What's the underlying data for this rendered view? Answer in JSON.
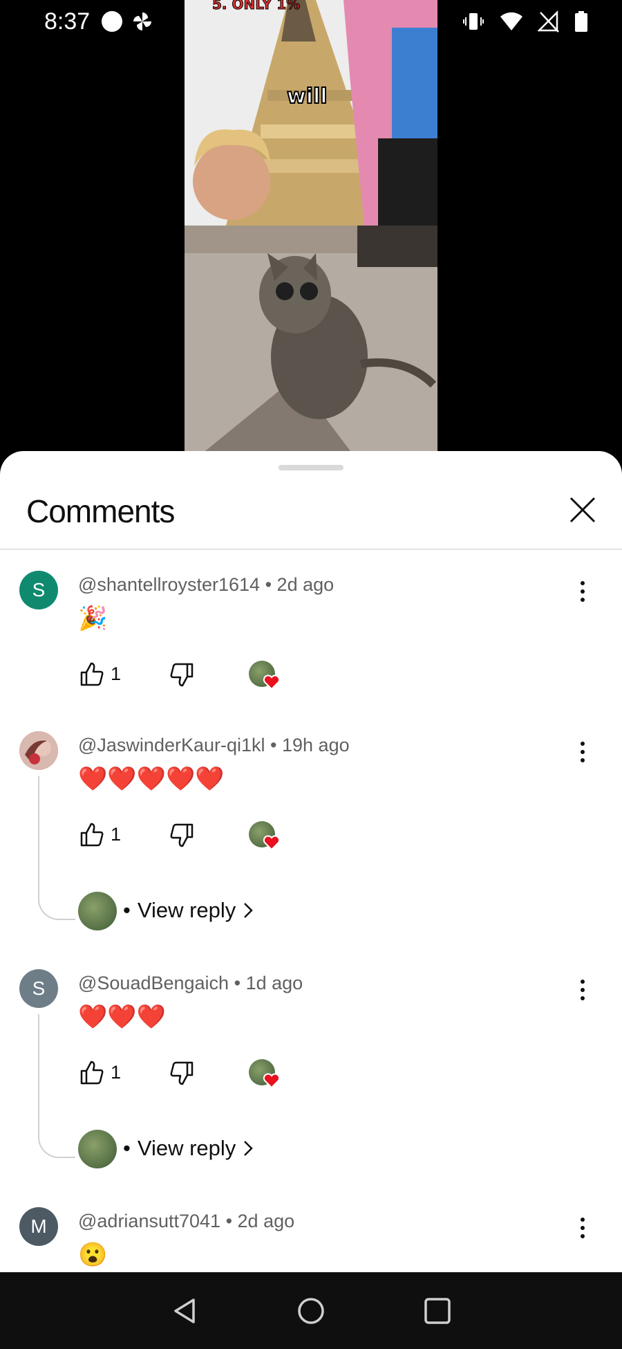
{
  "status_bar": {
    "time": "8:37",
    "left_icons": [
      "circle-dot-icon",
      "pinwheel-icon"
    ],
    "right_icons": [
      "vibrate-icon",
      "wifi-icon",
      "no-signal-icon",
      "battery-icon"
    ]
  },
  "video": {
    "banner_text": "5. ONLY 1%",
    "caption": "will"
  },
  "comments_panel": {
    "title": "Comments",
    "close_icon": "close-icon",
    "comments": [
      {
        "avatar_letter": "S",
        "avatar_color": "#0f8a6f",
        "author": "@shantellroyster1614",
        "age": "2d ago",
        "text": "🎉",
        "likes": "1",
        "creator_heart": true
      },
      {
        "avatar_letter": "",
        "avatar_color": "#c9a09a",
        "author": "@JaswinderKaur-qi1kl",
        "age": "19h ago",
        "text": "❤️❤️❤️❤️❤️",
        "likes": "1",
        "creator_heart": true,
        "reply_link": "View reply"
      },
      {
        "avatar_letter": "S",
        "avatar_color": "#6e7e88",
        "author": "@SouadBengaich",
        "age": "1d ago",
        "text": "❤️❤️❤️",
        "likes": "1",
        "creator_heart": true,
        "reply_link": "View reply"
      },
      {
        "avatar_letter": "M",
        "avatar_color": "#4d5a63",
        "author": "@adriansutt7041",
        "age": "2d ago",
        "text": "😮"
      }
    ]
  },
  "separator": "•",
  "nav_bar": {
    "buttons": [
      "back-icon",
      "home-icon",
      "recents-icon"
    ]
  }
}
